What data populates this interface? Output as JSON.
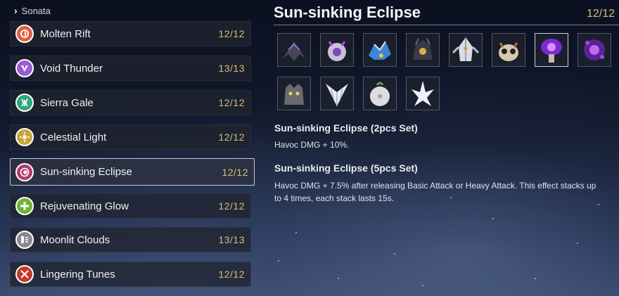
{
  "sidebar": {
    "header": "Sonata",
    "items": [
      {
        "name": "Molten Rift",
        "count": "12/12",
        "icon": "molten-rift-icon",
        "color": "#e0613a"
      },
      {
        "name": "Void Thunder",
        "count": "13/13",
        "icon": "void-thunder-icon",
        "color": "#9b5bd6"
      },
      {
        "name": "Sierra Gale",
        "count": "12/12",
        "icon": "sierra-gale-icon",
        "color": "#3fcf9a"
      },
      {
        "name": "Celestial Light",
        "count": "12/12",
        "icon": "celestial-light-icon",
        "color": "#e6c24a"
      },
      {
        "name": "Sun-sinking Eclipse",
        "count": "12/12",
        "icon": "sun-sinking-eclipse-icon",
        "color": "#c04a7a",
        "selected": true
      },
      {
        "name": "Rejuvenating Glow",
        "count": "12/12",
        "icon": "rejuvenating-glow-icon",
        "color": "#7cc83d"
      },
      {
        "name": "Moonlit Clouds",
        "count": "13/13",
        "icon": "moonlit-clouds-icon",
        "color": "#d8d8d8"
      },
      {
        "name": "Lingering Tunes",
        "count": "12/12",
        "icon": "lingering-tunes-icon",
        "color": "#d0422f"
      }
    ]
  },
  "detail": {
    "title": "Sun-sinking Eclipse",
    "count": "12/12",
    "echoes": [
      {
        "icon": "dark-raven-echo-icon",
        "color": "#8a6fd0"
      },
      {
        "icon": "purple-orb-creature-echo-icon",
        "color": "#b48fe8"
      },
      {
        "icon": "blue-crystal-beast-echo-icon",
        "color": "#5aa8f0"
      },
      {
        "icon": "dark-golem-echo-icon",
        "color": "#d2a24a"
      },
      {
        "icon": "white-knight-echo-icon",
        "color": "#e8e8f0"
      },
      {
        "icon": "horned-owl-echo-icon",
        "color": "#e0a070"
      },
      {
        "icon": "violet-mushroom-echo-icon",
        "color": "#9a4ae8",
        "selected": true
      },
      {
        "icon": "violet-spore-echo-icon",
        "color": "#a050e0"
      },
      {
        "icon": "grey-wolf-echo-icon",
        "color": "#bfbfc8"
      },
      {
        "icon": "frost-wing-echo-icon",
        "color": "#dde6f5"
      },
      {
        "icon": "white-bulb-echo-icon",
        "color": "#e4e4ea"
      },
      {
        "icon": "ice-spire-echo-icon",
        "color": "#e8eefa"
      }
    ],
    "effects": [
      {
        "title": "Sun-sinking Eclipse (2pcs Set)",
        "desc": "Havoc DMG + 10%."
      },
      {
        "title": "Sun-sinking Eclipse (5pcs Set)",
        "desc": "Havoc DMG + 7.5% after releasing Basic Attack or Heavy Attack. This effect stacks up to 4 times, each stack lasts 15s."
      }
    ]
  }
}
